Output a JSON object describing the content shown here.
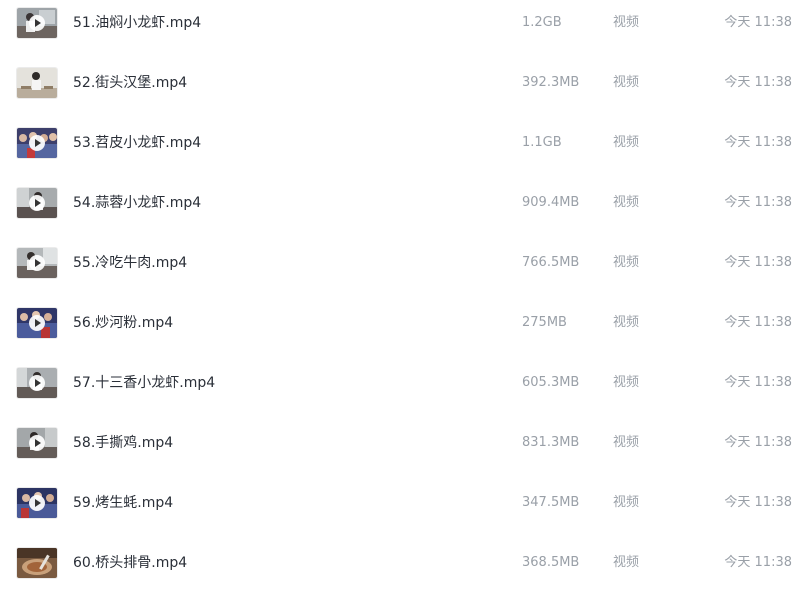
{
  "files": [
    {
      "name": "51.油焖小龙虾.mp4",
      "size": "1.2GB",
      "type": "视频",
      "time": "今天 11:38",
      "thumb_style": "kitchen",
      "has_play_icon": true
    },
    {
      "name": "52.街头汉堡.mp4",
      "size": "392.3MB",
      "type": "视频",
      "time": "今天 11:38",
      "thumb_style": "street",
      "has_play_icon": false
    },
    {
      "name": "53.苕皮小龙虾.mp4",
      "size": "1.1GB",
      "type": "视频",
      "time": "今天 11:38",
      "thumb_style": "crowd",
      "has_play_icon": true
    },
    {
      "name": "54.蒜蓉小龙虾.mp4",
      "size": "909.4MB",
      "type": "视频",
      "time": "今天 11:38",
      "thumb_style": "kitchen",
      "has_play_icon": true
    },
    {
      "name": "55.冷吃牛肉.mp4",
      "size": "766.5MB",
      "type": "视频",
      "time": "今天 11:38",
      "thumb_style": "kitchen",
      "has_play_icon": true
    },
    {
      "name": "56.炒河粉.mp4",
      "size": "275MB",
      "type": "视频",
      "time": "今天 11:38",
      "thumb_style": "crowd",
      "has_play_icon": true
    },
    {
      "name": "57.十三香小龙虾.mp4",
      "size": "605.3MB",
      "type": "视频",
      "time": "今天 11:38",
      "thumb_style": "kitchen",
      "has_play_icon": true
    },
    {
      "name": "58.手撕鸡.mp4",
      "size": "831.3MB",
      "type": "视频",
      "time": "今天 11:38",
      "thumb_style": "kitchen",
      "has_play_icon": true
    },
    {
      "name": "59.烤生蚝.mp4",
      "size": "347.5MB",
      "type": "视频",
      "time": "今天 11:38",
      "thumb_style": "crowd",
      "has_play_icon": true
    },
    {
      "name": "60.桥头排骨.mp4",
      "size": "368.5MB",
      "type": "视频",
      "time": "今天 11:38",
      "thumb_style": "food",
      "has_play_icon": false
    }
  ],
  "colors": {
    "name_text": "#2a2f38",
    "meta_text": "#9aa0a8",
    "background": "#ffffff"
  }
}
